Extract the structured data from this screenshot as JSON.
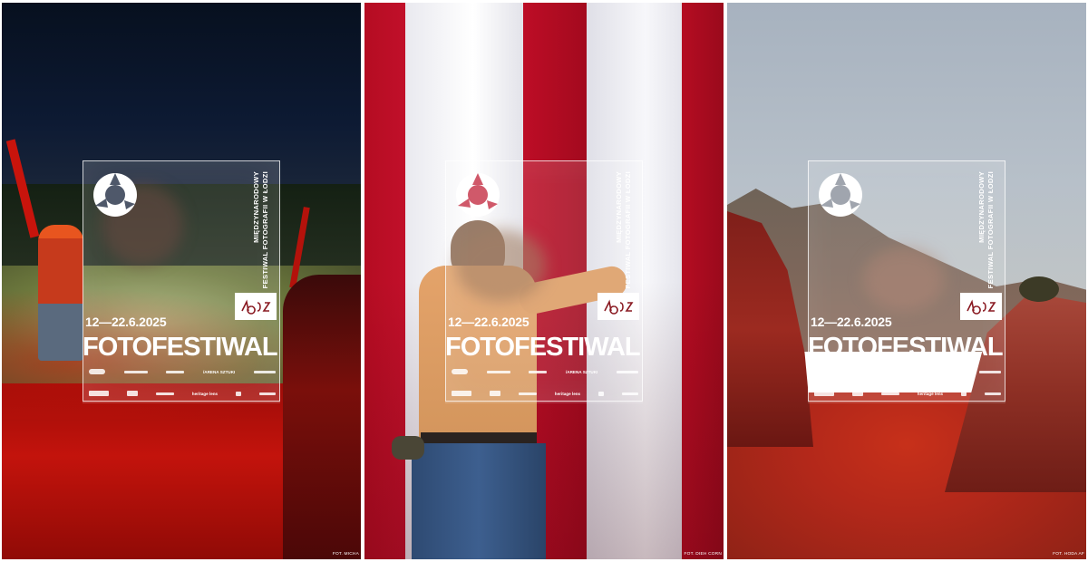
{
  "posters": [
    {
      "vertical_line1": "MIĘDZYNARODOWY",
      "vertical_line2": "FESTIWAL FOTOGRAFII W ŁODZI",
      "dates": "12—22.6.2025",
      "title": "FOTOFESTIWAL",
      "sponsor_text_a": "/ARENA SZTUKI",
      "sponsor_text_b": "heritage lens",
      "credit": "FOT. MICHA"
    },
    {
      "vertical_line1": "MIĘDZYNARODOWY",
      "vertical_line2": "FESTIWAL FOTOGRAFII W ŁODZI",
      "dates": "12—22.6.2025",
      "title": "FOTOFESTIWAL",
      "sponsor_text_a": "/ARENA SZTUKI",
      "sponsor_text_b": "heritage lens",
      "credit": "FOT. DIEH CORN"
    },
    {
      "vertical_line1": "MIĘDZYNARODOWY",
      "vertical_line2": "FESTIWAL FOTOGRAFII W ŁODZI",
      "dates": "12—22.6.2025",
      "title": "FOTOFESTIWAL",
      "sponsor_text_a": "/ARENA SZTUKI",
      "sponsor_text_b": "heritage lens",
      "credit": "FOT. HODA AF"
    }
  ],
  "colors": {
    "overlay_text": "#ffffff",
    "flag_red": "#b50c22",
    "lodz_logo": "#8a1a22"
  },
  "icons": [
    "fotofestiwal-logo-icon",
    "lodz-logo-icon"
  ]
}
